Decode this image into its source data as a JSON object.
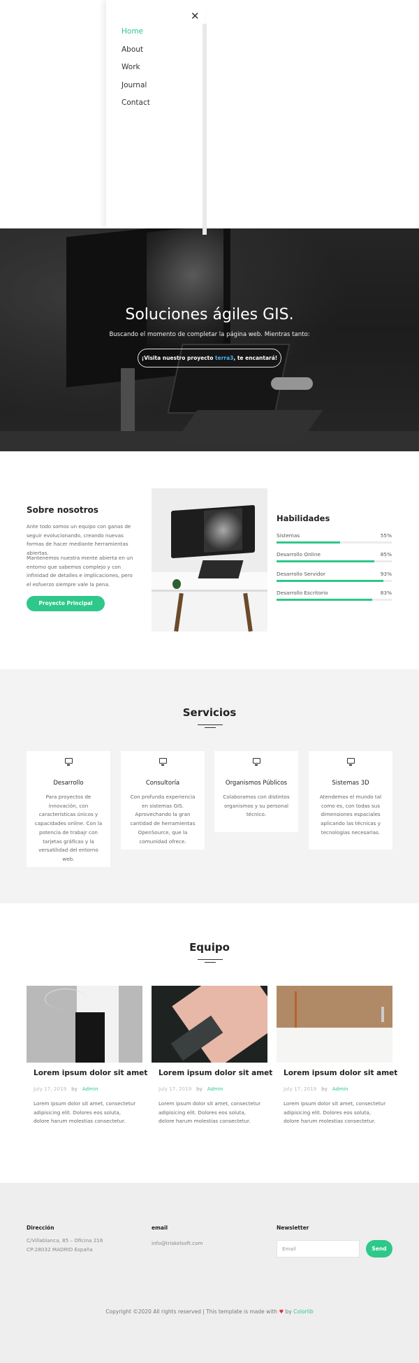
{
  "menu": {
    "close_icon": "close-icon",
    "items": [
      {
        "label": "Home",
        "active": true
      },
      {
        "label": "About"
      },
      {
        "label": "Work"
      },
      {
        "label": "Journal"
      },
      {
        "label": "Contact"
      }
    ]
  },
  "hero": {
    "title": "Soluciones ágiles GIS.",
    "subtitle": "Buscando el momento de completar la página web. Mientras tanto:",
    "button_pre": "¡Visita nuestro proyecto ",
    "button_link": "terra3",
    "button_post": ", te encantará!"
  },
  "about": {
    "title": "Sobre nosotros",
    "p1": "Ante todo somos un equipo con ganas de seguir evolucionando, creando nuevas formas de hacer mediante herramientas abiertas.",
    "p2": "Mantenemos nuestra mente abierta en un entorno que sabemos complejo y con infinidad de detalles e implicaciones, pero el esfuerzo siempre vale la pena.",
    "button": "Proyecto Principal"
  },
  "skills": {
    "title": "Habilidades",
    "items": [
      {
        "name": "Sistemas",
        "pct_label": "55%",
        "value": 0.55
      },
      {
        "name": "Desarrollo Online",
        "pct_label": "85%",
        "value": 0.85
      },
      {
        "name": "Desarrollo Servidor",
        "pct_label": "93%",
        "value": 0.93
      },
      {
        "name": "Desarrollo Escritorio",
        "pct_label": "83%",
        "value": 0.83
      }
    ]
  },
  "services": {
    "title": "Servicios",
    "cards": [
      {
        "icon": "monitor-icon",
        "title": "Desarrollo",
        "desc": "Para proyectos de innovación, con características únicos y capacidades online. Con la potencia de trabajr con tarjetas gráficas y la versatilidad del entorno web."
      },
      {
        "icon": "monitor-icon",
        "title": "Consultoría",
        "desc": "Con profunda experiencia en sistemas GIS. Aprovechando la gran cantidad de herramientas OpenSource, que la comunidad ofrece."
      },
      {
        "icon": "monitor-icon",
        "title": "Organismos Públicos",
        "desc": "Colaboramos con distintos organismos y su personal técnico."
      },
      {
        "icon": "monitor-icon",
        "title": "Sistemas 3D",
        "desc": "Atendemos el mundo tal como es, con todas sus dimensiones espaciales aplicando las técnicas y tecnologías necesarias."
      }
    ]
  },
  "team": {
    "title": "Equipo",
    "posts": [
      {
        "title": "Lorem ipsum dolor sit amet",
        "date": "July 17, 2019",
        "by": "by",
        "author": "Admin",
        "text": "Lorem ipsum dolor sit amet, consectetur adipisicing elit. Dolores eos soluta, dolore harum molestias consectetur."
      },
      {
        "title": "Lorem ipsum dolor sit amet",
        "date": "July 17, 2019",
        "by": "by",
        "author": "Admin",
        "text": "Lorem ipsum dolor sit amet, consectetur adipisicing elit. Dolores eos soluta, dolore harum molestias consectetur."
      },
      {
        "title": "Lorem ipsum dolor sit amet",
        "date": "July 17, 2019",
        "by": "by",
        "author": "Admin",
        "text": "Lorem ipsum dolor sit amet, consectetur adipisicing elit. Dolores eos soluta, dolore harum molestias consectetur."
      }
    ]
  },
  "footer": {
    "address_title": "Dirección",
    "address_line1": "C/Villablanca, 85 – Oficina 216",
    "address_line2": "CP:28032 MADRID España",
    "email_title": "email",
    "email": "info@triskelsoft.com",
    "newsletter_title": "Newsletter",
    "newsletter_placeholder": "Email",
    "send": "Send",
    "copyright_pre": "Copyright ©2020 All rights reserved | This template is made with",
    "copyright_by": "by",
    "copyright_link": "Colorlib",
    "heart_icon": "heart-icon",
    "accent": "#2ec88a"
  }
}
